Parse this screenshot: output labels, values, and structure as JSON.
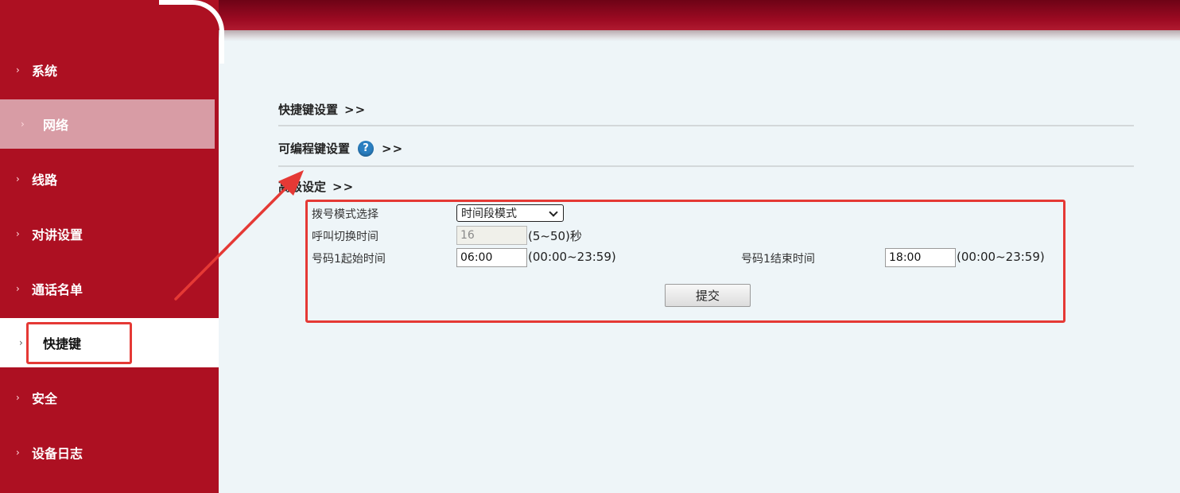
{
  "sidebar": {
    "items": [
      {
        "label": "系统"
      },
      {
        "label": "网络"
      },
      {
        "label": "线路"
      },
      {
        "label": "对讲设置"
      },
      {
        "label": "通话名单"
      },
      {
        "label": "快捷键"
      },
      {
        "label": "安全"
      },
      {
        "label": "设备日志"
      }
    ],
    "chevron": "›"
  },
  "sections": {
    "shortcut": {
      "label": "快捷键设置",
      "arrows": ">>"
    },
    "programmable": {
      "label": "可编程键设置",
      "arrows": ">>",
      "help_icon": "?"
    },
    "advanced": {
      "label": "高级设定",
      "arrows": ">>"
    }
  },
  "form": {
    "dial_mode": {
      "label": "拨号模式选择",
      "value": "时间段模式"
    },
    "call_switch": {
      "label": "呼叫切换时间",
      "value": "16",
      "hint": "(5~50)秒"
    },
    "start_time": {
      "label": "号码1起始时间",
      "value": "06:00",
      "hint": "(00:00~23:59)"
    },
    "end_time": {
      "label": "号码1结束时间",
      "value": "18:00",
      "hint": "(00:00~23:59)"
    },
    "submit_label": "提交"
  },
  "colors": {
    "sidebar": "#ad1022",
    "annotation": "#e53935",
    "help_icon": "#2a7fc1"
  }
}
